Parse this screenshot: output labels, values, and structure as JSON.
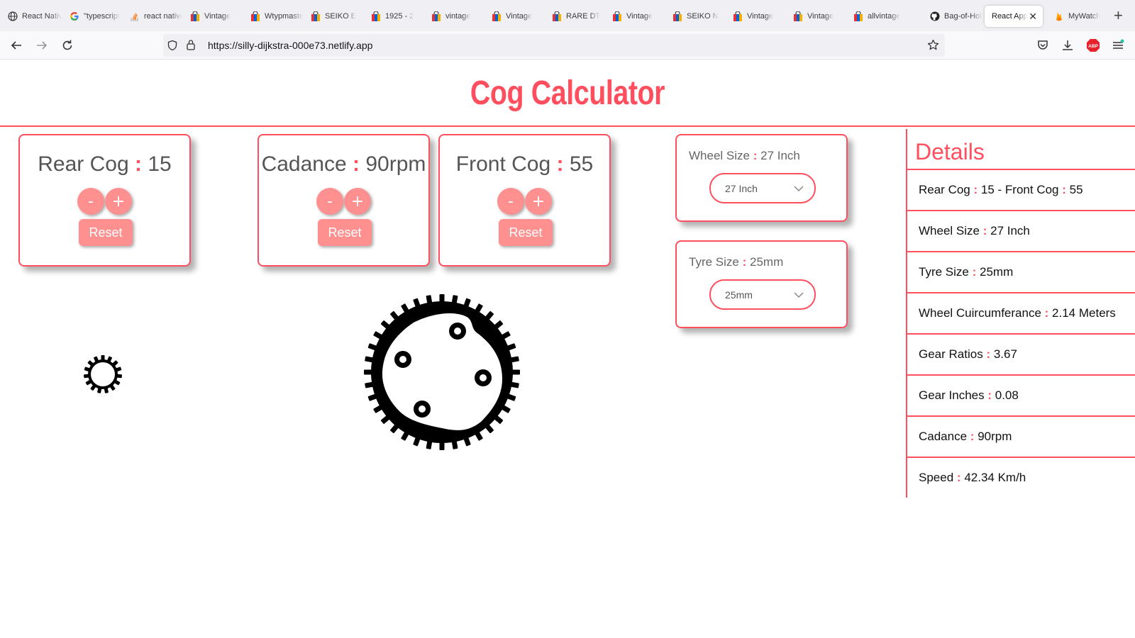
{
  "browser": {
    "tabs": [
      {
        "label": "React Native",
        "icon": "globe-icon"
      },
      {
        "label": "\"typescript",
        "icon": "google-icon"
      },
      {
        "label": "react native",
        "icon": "stackoverflow-icon"
      },
      {
        "label": "Vintage",
        "icon": "shopping-bag-icon"
      },
      {
        "label": "Wtypmaster",
        "icon": "shopping-bag-icon"
      },
      {
        "label": "SEIKO E",
        "icon": "shopping-bag-icon"
      },
      {
        "label": "1925 - 2",
        "icon": "shopping-bag-icon"
      },
      {
        "label": "vintage",
        "icon": "shopping-bag-icon"
      },
      {
        "label": "Vintage",
        "icon": "shopping-bag-icon"
      },
      {
        "label": "RARE DT",
        "icon": "shopping-bag-icon"
      },
      {
        "label": "Vintage",
        "icon": "shopping-bag-icon"
      },
      {
        "label": "SEIKO N",
        "icon": "shopping-bag-icon"
      },
      {
        "label": "Vintage",
        "icon": "shopping-bag-icon"
      },
      {
        "label": "Vintage",
        "icon": "shopping-bag-icon"
      },
      {
        "label": "allvintage",
        "icon": "shopping-bag-icon"
      },
      {
        "label": "Bag-of-Holding",
        "icon": "github-icon"
      },
      {
        "label": "React App",
        "icon": "none",
        "active": true
      },
      {
        "label": "MyWatch",
        "icon": "firebase-icon"
      }
    ],
    "url": "https://silly-dijkstra-000e73.netlify.app"
  },
  "app": {
    "title": "Cog Calculator",
    "accent_color": "#ff4f5e",
    "button_color": "#ff9090",
    "rear_cog": {
      "label": "Rear Cog",
      "colon": ":",
      "value": "15",
      "minus": "-",
      "plus": "+",
      "reset": "Reset"
    },
    "cadence": {
      "label": "Cadance",
      "colon": ":",
      "value": "90rpm",
      "minus": "-",
      "plus": "+",
      "reset": "Reset"
    },
    "front_cog": {
      "label": "Front Cog",
      "colon": ":",
      "value": "55",
      "minus": "-",
      "plus": "+",
      "reset": "Reset"
    },
    "wheel_size": {
      "label": "Wheel Size",
      "colon": ":",
      "value": "27 Inch",
      "selected": "27 Inch"
    },
    "tyre_size": {
      "label": "Tyre Size",
      "colon": ":",
      "value": "25mm",
      "selected": "25mm"
    }
  },
  "details": {
    "title": "Details",
    "colon": ":",
    "rows": [
      {
        "label": "Rear Cog",
        "value": "15 - Front Cog",
        "label2": ":",
        "value2": "55"
      },
      {
        "label": "Wheel Size",
        "value": "27 Inch"
      },
      {
        "label": "Tyre Size",
        "value": "25mm"
      },
      {
        "label": "Wheel Cuircumferance",
        "value": "2.14 Meters"
      },
      {
        "label": "Gear Ratios",
        "value": "3.67"
      },
      {
        "label": "Gear Inches",
        "value": "0.08"
      },
      {
        "label": "Cadance",
        "value": "90rpm"
      },
      {
        "label": "Speed",
        "value": "42.34 Km/h"
      }
    ]
  }
}
